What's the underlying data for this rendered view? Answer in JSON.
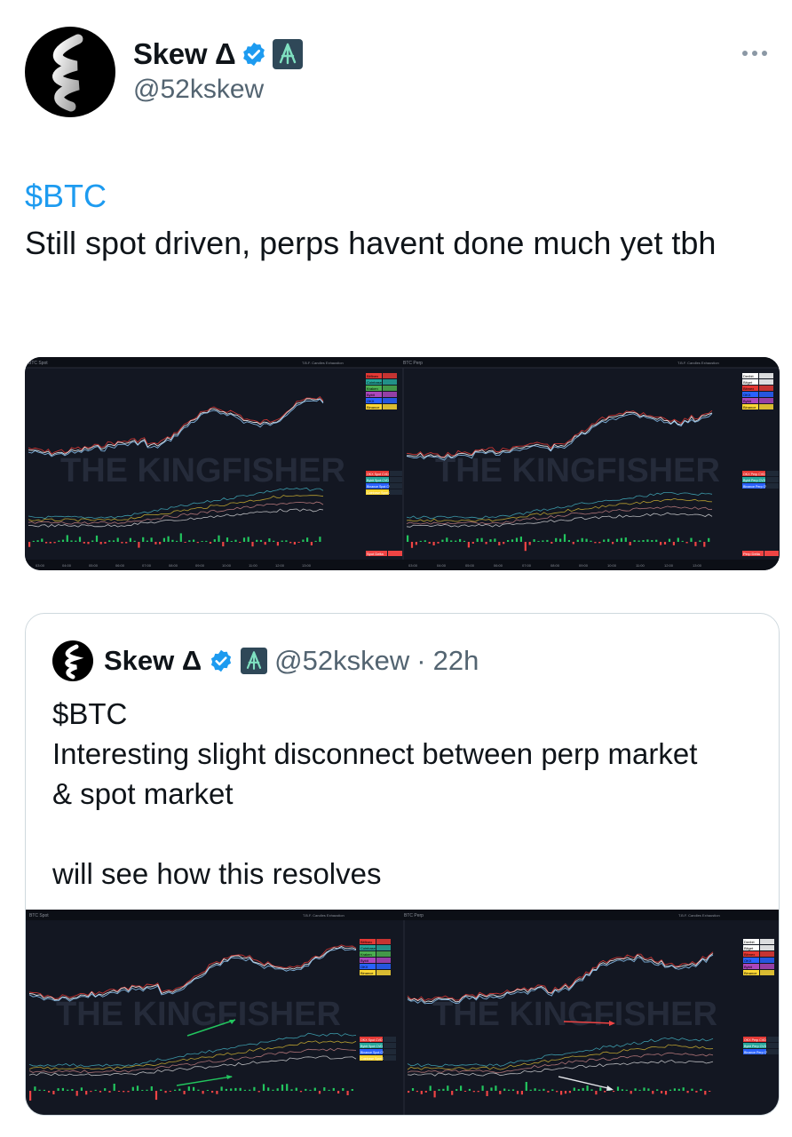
{
  "tweet": {
    "author_name": "Skew Δ",
    "author_handle": "@52kskew",
    "cashtag": "$BTC",
    "body": "Still spot driven, perps havent done much yet tbh",
    "icons": {
      "avatar": "spiral-logo-icon",
      "verified": "verified-badge-icon",
      "affiliate": "affiliate-badge-icon",
      "more": "more-icon"
    }
  },
  "chart_images": {
    "watermark": "THE KINGFISHER",
    "left_title": "BTC Spot",
    "right_title": "BTC Perp",
    "toolbar": "T.B.F.  Candles Exhaustion",
    "left_legend": [
      "Bitfinex",
      "Coinbase",
      "Kraken",
      "Bybit",
      "OKX",
      "Binance"
    ],
    "left_legend_colors": [
      "#e53935",
      "#26a69a",
      "#4caf50",
      "#ab47bc",
      "#2962ff",
      "#fdd835"
    ],
    "right_legend": [
      "Deribit",
      "Bitget",
      "Bitmex",
      "OKX",
      "Bybit",
      "Binance"
    ],
    "right_legend_colors": [
      "#ffffff",
      "#ffffff",
      "#e53935",
      "#2962ff",
      "#ab47bc",
      "#fdd835"
    ],
    "cvd_labels_left": [
      "OKX Spot CVD",
      "Bybit Spot CVD",
      "Binance Spot CVD",
      "Coinbase Spot CVD"
    ],
    "cvd_labels_right": [
      "OKX Perp CVD",
      "Bybit Perp CVD",
      "Binance Perp CVD"
    ],
    "delta_left": "Spot Delta",
    "delta_right": "Perp Delta",
    "time_ticks": [
      "03:00",
      "04:00",
      "05:00",
      "06:00",
      "07:00",
      "08:00",
      "09:00",
      "10:00",
      "11:00",
      "12:00",
      "13:00"
    ]
  },
  "quoted_tweet": {
    "author_name": "Skew Δ",
    "author_handle": "@52kskew",
    "separator": "·",
    "time": "22h",
    "cashtag": "$BTC",
    "line1": "Interesting slight disconnect between perp market",
    "line2": "& spot market",
    "line3": "will see how this resolves"
  }
}
